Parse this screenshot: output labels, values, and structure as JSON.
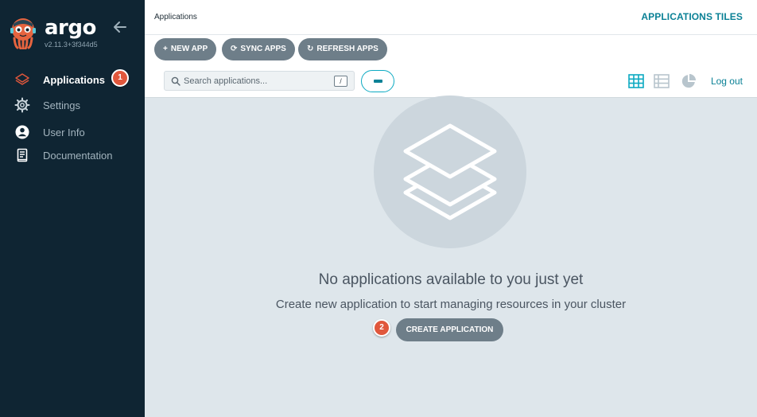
{
  "sidebar": {
    "brand": "argo",
    "version": "v2.11.3+3f344d5",
    "items": [
      {
        "label": "Applications",
        "icon": "layers-icon",
        "active": true
      },
      {
        "label": "Settings",
        "icon": "gear-icon",
        "active": false
      },
      {
        "label": "User Info",
        "icon": "user-icon",
        "active": false
      },
      {
        "label": "Documentation",
        "icon": "book-icon",
        "active": false
      }
    ],
    "badge": "1"
  },
  "header": {
    "breadcrumb": "Applications",
    "title": "APPLICATIONS TILES"
  },
  "toolbar": {
    "new_app_label": "NEW APP",
    "sync_apps_label": "SYNC APPS",
    "refresh_apps_label": "REFRESH APPS",
    "search_placeholder": "Search applications...",
    "search_shortcut": "/",
    "logout_label": "Log out",
    "view_modes": [
      "tiles-view-icon",
      "list-view-icon",
      "summary-pie-icon"
    ]
  },
  "empty_state": {
    "title": "No applications available to you just yet",
    "subtitle": "Create new application to start managing resources in your cluster",
    "create_label": "CREATE APPLICATION",
    "badge": "2"
  },
  "colors": {
    "sidebar_bg": "#0f2533",
    "main_bg": "#dee6eb",
    "accent": "#0b8196",
    "button_bg": "#6e7e89",
    "badge_bg": "#e0573c"
  }
}
